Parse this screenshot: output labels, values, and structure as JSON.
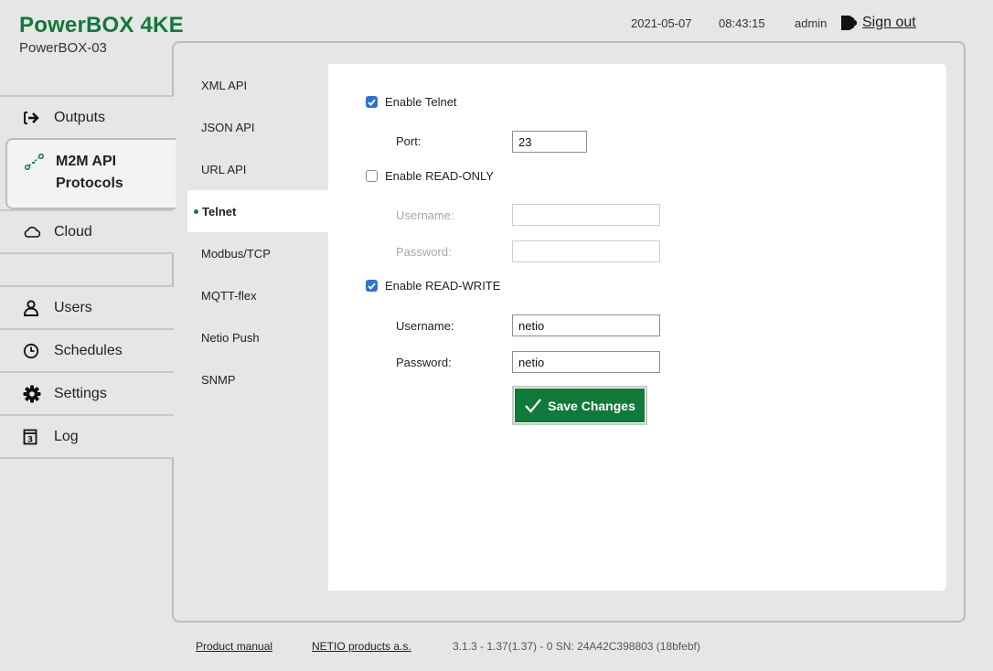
{
  "header": {
    "title": "PowerBOX 4KE",
    "device_name": "PowerBOX-03",
    "date": "2021-05-07",
    "time": "08:43:15",
    "user": "admin",
    "sign_out": "Sign out"
  },
  "nav": {
    "outputs": "Outputs",
    "m2m_line1": "M2M API",
    "m2m_line2": "Protocols",
    "cloud": "Cloud",
    "users": "Users",
    "schedules": "Schedules",
    "settings": "Settings",
    "log": "Log"
  },
  "subnav": {
    "items": [
      "XML API",
      "JSON API",
      "URL API",
      "Telnet",
      "Modbus/TCP",
      "MQTT-flex",
      "Netio Push",
      "SNMP"
    ],
    "active": "Telnet"
  },
  "form": {
    "enable_telnet": "Enable Telnet",
    "port_label": "Port:",
    "port_value": "23",
    "enable_readonly": "Enable READ-ONLY",
    "ro_username_label": "Username:",
    "ro_username_value": "",
    "ro_password_label": "Password:",
    "ro_password_value": "",
    "enable_readwrite": "Enable READ-WRITE",
    "rw_username_label": "Username:",
    "rw_username_value": "netio",
    "rw_password_label": "Password:",
    "rw_password_value": "netio",
    "save": "Save Changes"
  },
  "footer": {
    "manual": "Product manual",
    "company": "NETIO products a.s.",
    "version": "3.1.3 - 1.37(1.37) - 0 SN: 24A42C398803 (18bfebf)"
  },
  "colors": {
    "brand": "#0f7a3a",
    "checkbox": "#2f74d0"
  },
  "icons": {
    "outputs": "arrow-right-bracket-icon",
    "m2m": "nodes-icon",
    "cloud": "cloud-icon",
    "users": "user-icon",
    "schedules": "clock-icon",
    "settings": "gear-icon",
    "log": "calendar-icon",
    "sign_out": "sign-out-icon",
    "save": "checkmark-icon"
  }
}
